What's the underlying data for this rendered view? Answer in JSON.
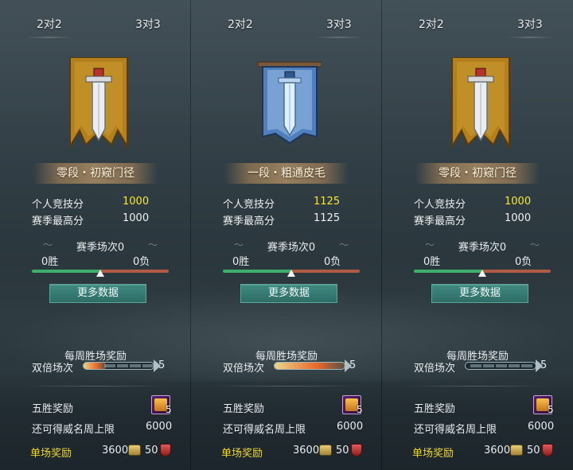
{
  "panels": [
    {
      "tabs": [
        "2对2",
        "3对3"
      ],
      "active_tab": 0,
      "rank": "零段・初窥门径",
      "banner_color": "#b3801c",
      "stats": [
        {
          "label": "个人竞技分",
          "value": "1000"
        },
        {
          "label": "赛季最高分",
          "value": "1000"
        }
      ],
      "season_label": "赛季场次0",
      "wins": "0胜",
      "losses": "0负",
      "more_button": "更多数据",
      "weekly_title": "每周胜场奖励",
      "double_label": "双倍场次",
      "double_count": "5",
      "five_win_label": "五胜奖励",
      "five_win_count": "5",
      "limit_label": "还可得威名周上限",
      "limit_value": "6000",
      "single_label": "单场奖励",
      "single_coin": "3600",
      "single_shield": "50"
    },
    {
      "tabs": [
        "2对2",
        "3对3"
      ],
      "active_tab": 1,
      "rank": "一段・粗通皮毛",
      "banner_color": "#4f7fbd",
      "stats": [
        {
          "label": "个人竞技分",
          "value": "1125"
        },
        {
          "label": "赛季最高分",
          "value": "1125"
        }
      ],
      "season_label": "赛季场次0",
      "wins": "0胜",
      "losses": "0负",
      "more_button": "更多数据",
      "weekly_title": "每周胜场奖励",
      "double_label": "双倍场次",
      "double_count": "5",
      "five_win_label": "五胜奖励",
      "five_win_count": "5",
      "limit_label": "还可得威名周上限",
      "limit_value": "6000",
      "single_label": "单场奖励",
      "single_coin": "3600",
      "single_shield": "50"
    },
    {
      "tabs": [
        "2对2",
        "3对3"
      ],
      "active_tab": 1,
      "rank": "零段・初窥门径",
      "banner_color": "#b3801c",
      "stats": [
        {
          "label": "个人竞技分",
          "value": "1000"
        },
        {
          "label": "赛季最高分",
          "value": "1000"
        }
      ],
      "season_label": "赛季场次0",
      "wins": "0胜",
      "losses": "0负",
      "more_button": "更多数据",
      "weekly_title": "每周胜场奖励",
      "double_label": "双倍场次",
      "double_count": "5",
      "five_win_label": "五胜奖励",
      "five_win_count": "5",
      "limit_label": "还可得威名周上限",
      "limit_value": "6000",
      "single_label": "单场奖励",
      "single_coin": "3600",
      "single_shield": "50"
    }
  ],
  "colors": {
    "highlight_score": "#f4e53a",
    "win_bar": "#3fae6d",
    "loss_bar": "#b25a44",
    "button": "#2e6d66",
    "single_reward": "#ead53a"
  }
}
